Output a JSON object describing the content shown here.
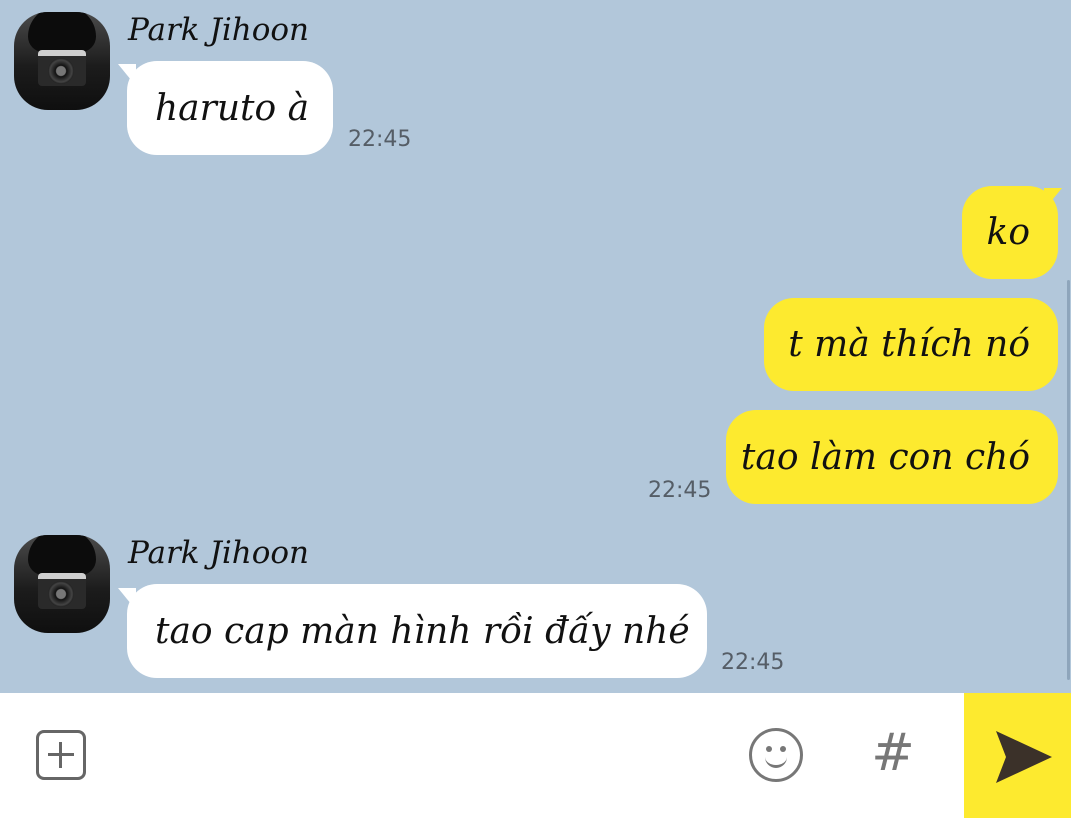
{
  "messages": [
    {
      "sender": "Park Jihoon",
      "text": "haruto à",
      "time": "22:45",
      "direction": "incoming"
    },
    {
      "text": "ko",
      "direction": "outgoing"
    },
    {
      "text": "t mà thích nó",
      "direction": "outgoing"
    },
    {
      "text": "tao làm con chó",
      "time": "22:45",
      "direction": "outgoing"
    },
    {
      "sender": "Park Jihoon",
      "text": "tao cap màn hình rồi đấy nhé",
      "time": "22:45",
      "direction": "incoming"
    }
  ],
  "composer": {
    "plus_icon": "plus-square-icon",
    "emoji_icon": "smiley-icon",
    "hash_label": "#",
    "send_icon": "send-arrow-icon"
  },
  "colors": {
    "background": "#b2c7da",
    "incoming_bubble": "#ffffff",
    "outgoing_bubble": "#fdea2f",
    "send_button": "#fdea2f"
  }
}
